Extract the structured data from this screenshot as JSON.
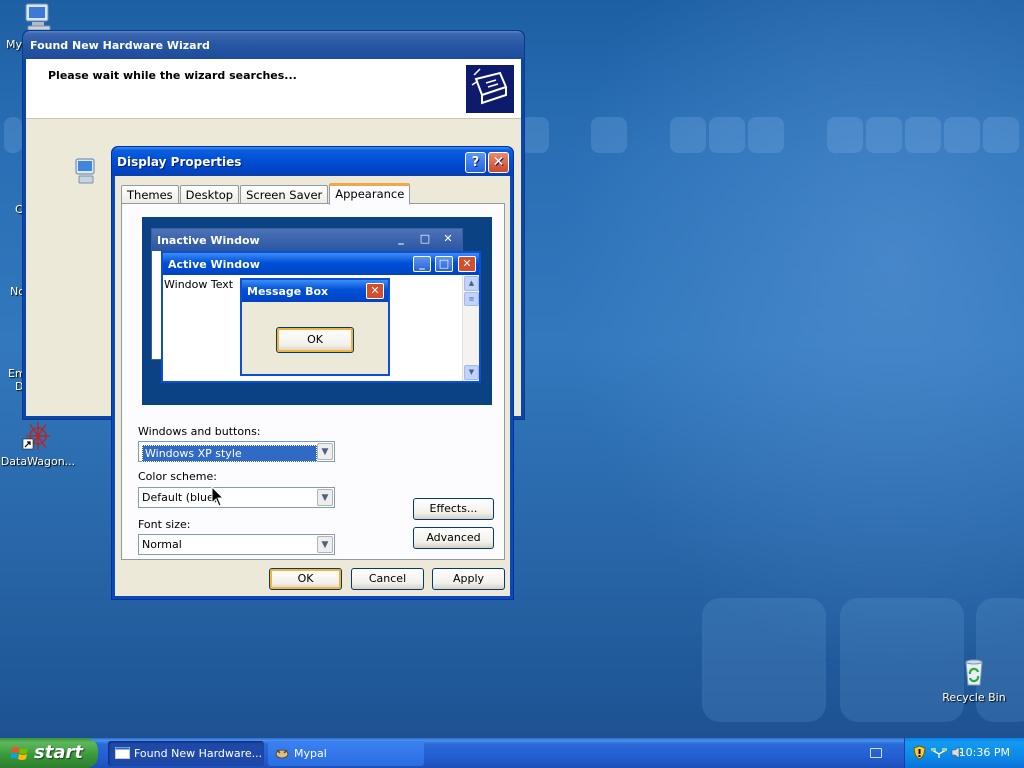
{
  "desktop": {
    "icons": [
      {
        "label": "DataWagon...",
        "icon": "datawagon-icon"
      },
      {
        "label": "Recycle Bin",
        "icon": "recycle-bin-icon"
      }
    ],
    "partial_labels": [
      "My",
      "C",
      "No",
      "Em",
      "D"
    ]
  },
  "wizard": {
    "title": "Found New Hardware Wizard",
    "message": "Please wait while the wizard searches..."
  },
  "display_properties": {
    "title": "Display Properties",
    "help_glyph": "?",
    "close_glyph": "✕",
    "tabs": [
      {
        "label": "Themes",
        "active": false
      },
      {
        "label": "Desktop",
        "active": false
      },
      {
        "label": "Screen Saver",
        "active": false
      },
      {
        "label": "Appearance",
        "active": true
      }
    ],
    "preview": {
      "inactive_title": "Inactive Window",
      "active_title": "Active Window",
      "window_text": "Window Text",
      "message_box_title": "Message Box",
      "message_box_ok": "OK"
    },
    "windows_buttons_label": "Windows and buttons:",
    "windows_buttons_value": "Windows XP style",
    "color_scheme_label": "Color scheme:",
    "color_scheme_value": "Default (blue)",
    "font_size_label": "Font size:",
    "font_size_value": "Normal",
    "effects_label": "Effects...",
    "advanced_label": "Advanced",
    "ok_label": "OK",
    "cancel_label": "Cancel",
    "apply_label": "Apply"
  },
  "taskbar": {
    "start_label": "start",
    "items": [
      {
        "label": "Found New Hardware...",
        "active": true
      },
      {
        "label": "Mypal",
        "active": false
      }
    ],
    "clock": "10:36 PM"
  },
  "colors": {
    "title_active": "#0050d8",
    "title_inactive": "#1d4d9a",
    "dialog_bg": "#ece9d8",
    "tab_highlight": "#f3a74a",
    "selection": "#316ac5",
    "start_green": "#3a9a3a"
  }
}
